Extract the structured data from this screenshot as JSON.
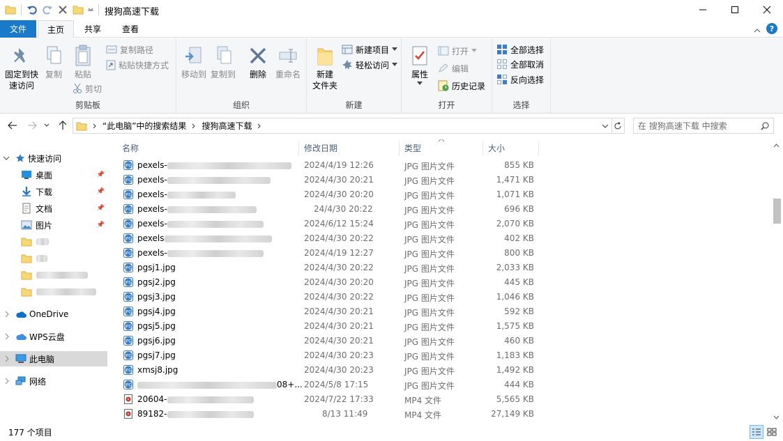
{
  "window": {
    "title": "搜狗高速下载"
  },
  "tabs": {
    "file": "文件",
    "home": "主页",
    "share": "共享",
    "view": "查看"
  },
  "ribbon": {
    "clipboard": {
      "label": "剪贴板",
      "pin": "固定到快速访问",
      "copy": "复制",
      "paste": "粘贴",
      "copy_path": "复制路径",
      "paste_shortcut": "粘贴快捷方式",
      "cut": "剪切"
    },
    "organize": {
      "label": "组织",
      "move_to": "移动到",
      "copy_to": "复制到",
      "delete": "删除",
      "rename": "重命名"
    },
    "new": {
      "label": "新建",
      "new_folder": "新建\n文件夹",
      "new_item": "新建项目",
      "easy_access": "轻松访问"
    },
    "open": {
      "label": "打开",
      "properties": "属性",
      "open": "打开",
      "edit": "编辑",
      "history": "历史记录"
    },
    "select": {
      "label": "选择",
      "select_all": "全部选择",
      "select_none": "全部取消",
      "invert": "反向选择"
    }
  },
  "address": {
    "crumb1": "“此电脑”中的搜索结果",
    "crumb2": "搜狗高速下载",
    "search_placeholder": "在 搜狗高速下载 中搜索"
  },
  "nav": {
    "quick_access": "快速访问",
    "desktop": "桌面",
    "downloads": "下载",
    "documents": "文档",
    "pictures": "图片",
    "onedrive": "OneDrive",
    "wps": "WPS云盘",
    "this_pc": "此电脑",
    "network": "网络"
  },
  "columns": {
    "name": "名称",
    "date": "修改日期",
    "type": "类型",
    "size": "大小"
  },
  "files": [
    {
      "name": "pexels-",
      "date": "2024/4/19 12:26",
      "type": "JPG 图片文件",
      "size": "855 KB",
      "icon": "jpg-icon"
    },
    {
      "name": "pexels-",
      "date": "2024/4/30 20:21",
      "type": "JPG 图片文件",
      "size": "1,471 KB",
      "icon": "jpg-icon"
    },
    {
      "name": "pexels-",
      "date": "2024/4/30 20:20",
      "type": "JPG 图片文件",
      "size": "1,071 KB",
      "icon": "jpg-icon"
    },
    {
      "name": "pexels-",
      "date": "24/4/30 20:22",
      "type": "JPG 图片文件",
      "size": "696 KB",
      "icon": "jpg-icon"
    },
    {
      "name": "pexels-",
      "date": "2024/6/12 15:24",
      "type": "JPG 图片文件",
      "size": "2,070 KB",
      "icon": "jpg-icon"
    },
    {
      "name": "pexels",
      "date": "2024/4/30 20:22",
      "type": "JPG 图片文件",
      "size": "402 KB",
      "icon": "jpg-icon"
    },
    {
      "name": "pexels-",
      "date": "2024/4/19 12:27",
      "type": "JPG 图片文件",
      "size": "800 KB",
      "icon": "jpg-icon"
    },
    {
      "name": "pgsj1.jpg",
      "date": "2024/4/30 20:22",
      "type": "JPG 图片文件",
      "size": "2,033 KB",
      "icon": "jpg-icon"
    },
    {
      "name": "pgsj2.jpg",
      "date": "2024/4/30 20:20",
      "type": "JPG 图片文件",
      "size": "445 KB",
      "icon": "jpg-icon"
    },
    {
      "name": "pgsj3.jpg",
      "date": "2024/4/30 20:22",
      "type": "JPG 图片文件",
      "size": "1,046 KB",
      "icon": "jpg-icon"
    },
    {
      "name": "pgsj4.jpg",
      "date": "2024/4/30 20:21",
      "type": "JPG 图片文件",
      "size": "592 KB",
      "icon": "jpg-icon"
    },
    {
      "name": "pgsj5.jpg",
      "date": "2024/4/30 20:21",
      "type": "JPG 图片文件",
      "size": "1,575 KB",
      "icon": "jpg-icon"
    },
    {
      "name": "pgsj6.jpg",
      "date": "2024/4/30 20:21",
      "type": "JPG 图片文件",
      "size": "460 KB",
      "icon": "jpg-icon"
    },
    {
      "name": "pgsj7.jpg",
      "date": "2024/4/30 20:23",
      "type": "JPG 图片文件",
      "size": "1,183 KB",
      "icon": "jpg-icon"
    },
    {
      "name": "xmsj8.jpg",
      "date": "2024/4/30 20:23",
      "type": "JPG 图片文件",
      "size": "1,492 KB",
      "icon": "jpg-icon"
    },
    {
      "name": "08+...",
      "date": "2024/5/8 17:15",
      "type": "JPG 图片文件",
      "size": "444 KB",
      "icon": "jpg-icon"
    },
    {
      "name": "20604-",
      "date": "2024/7/22 17:33",
      "type": "MP4 文件",
      "size": "5,565 KB",
      "icon": "mp4-icon"
    },
    {
      "name": "89182-",
      "date": "8/13 11:49",
      "type": "MP4 文件",
      "size": "27,149 KB",
      "icon": "mp4-icon"
    }
  ],
  "status": {
    "count": "177 个项目"
  }
}
